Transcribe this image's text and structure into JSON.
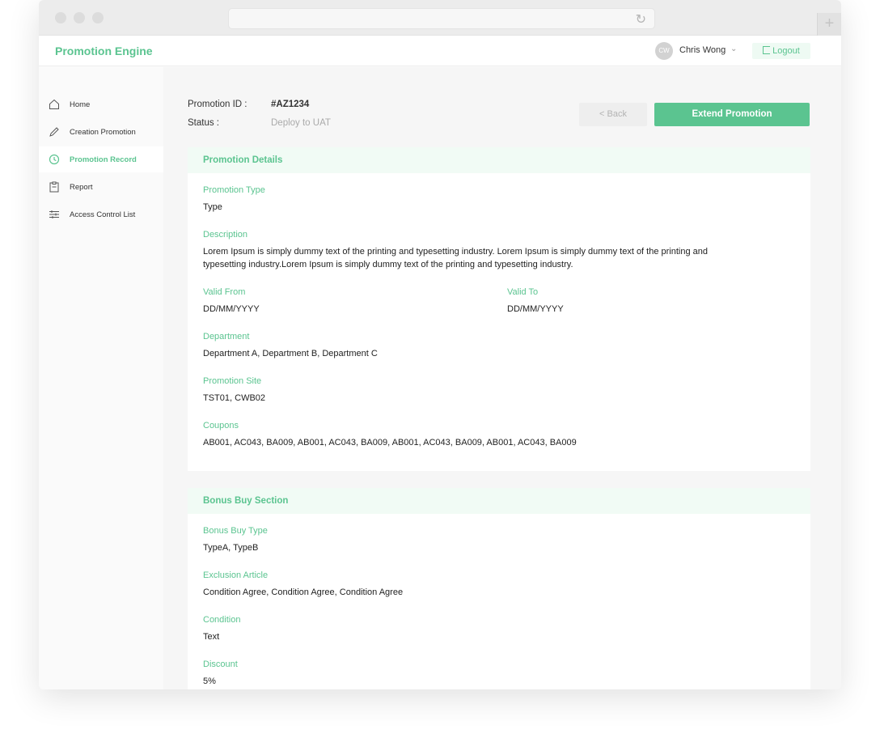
{
  "app": {
    "brand": "Promotion Engine",
    "user": {
      "initials": "CW",
      "name": "Chris Wong"
    },
    "logout_label": "Logout"
  },
  "sidebar": {
    "items": [
      {
        "label": "Home",
        "icon": "home-icon",
        "active": false
      },
      {
        "label": "Creation Promotion",
        "icon": "pencil-icon",
        "active": false
      },
      {
        "label": "Promotion Record",
        "icon": "clock-icon",
        "active": true
      },
      {
        "label": "Report",
        "icon": "clipboard-icon",
        "active": false
      },
      {
        "label": "Access Control List",
        "icon": "sliders-icon",
        "active": false
      }
    ]
  },
  "promotion": {
    "id_label": "Promotion ID :",
    "id_value": "#AZ1234",
    "status_label": "Status :",
    "status_value": "Deploy to UAT"
  },
  "actions": {
    "back_label": "< Back",
    "extend_label": "Extend Promotion"
  },
  "details": {
    "title": "Promotion Details",
    "type_label": "Promotion Type",
    "type_value": "Type",
    "description_label": "Description",
    "description_line1": "Lorem Ipsum is simply dummy text of the printing and typesetting industry. Lorem Ipsum is simply dummy text of the printing and",
    "description_line2": "typesetting industry.Lorem Ipsum is simply dummy text of the printing and typesetting industry.",
    "valid_from_label": "Valid From",
    "valid_from_value": "DD/MM/YYYY",
    "valid_to_label": "Valid To",
    "valid_to_value": "DD/MM/YYYY",
    "department_label": "Department",
    "department_value": "Department A, Department B, Department C",
    "site_label": "Promotion Site",
    "site_value": "TST01, CWB02",
    "coupons_label": "Coupons",
    "coupons_value": "AB001, AC043, BA009, AB001, AC043, BA009, AB001, AC043, BA009, AB001, AC043, BA009"
  },
  "bonus": {
    "title": "Bonus Buy Section",
    "type_label": "Bonus Buy Type",
    "type_value": "TypeA, TypeB",
    "exclusion_label": "Exclusion Article",
    "exclusion_value": "Condition Agree, Condition Agree, Condition Agree",
    "condition_label": "Condition",
    "condition_value": "Text",
    "discount_label": "Discount",
    "discount_value": "5%"
  },
  "colors": {
    "accent": "#5bc490",
    "accent_light": "#f1fbf5"
  }
}
